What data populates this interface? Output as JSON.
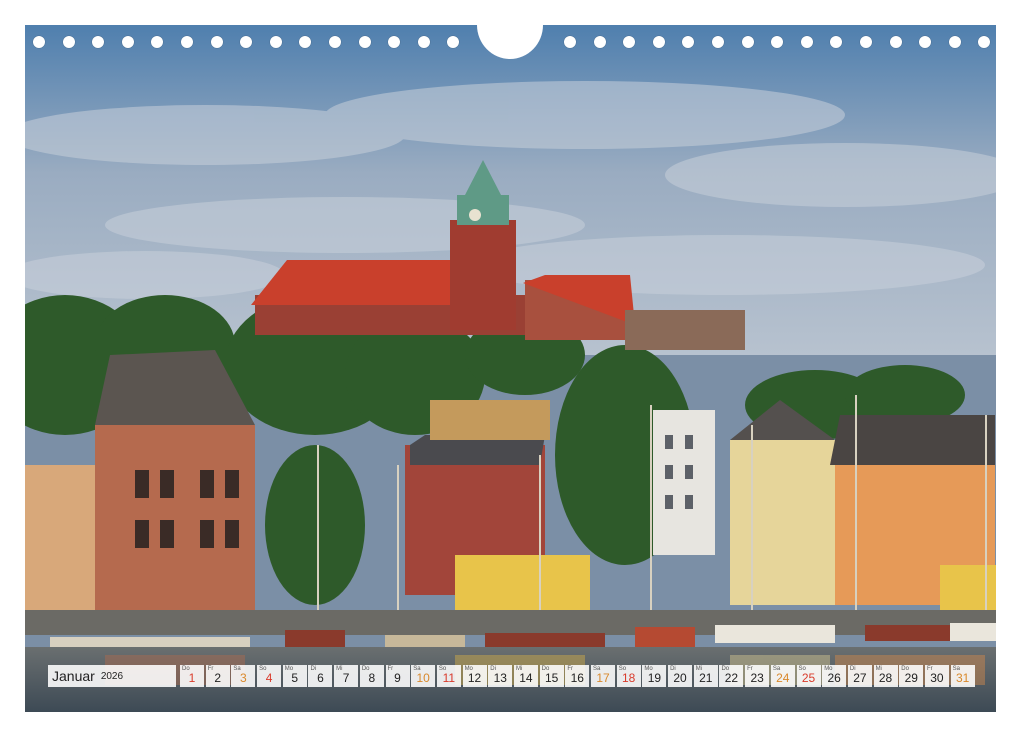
{
  "calendar": {
    "month": "Januar",
    "year": "2026",
    "days": [
      {
        "n": "1",
        "wd": "Do",
        "type": "hol"
      },
      {
        "n": "2",
        "wd": "Fr",
        "type": ""
      },
      {
        "n": "3",
        "wd": "Sa",
        "type": "sat"
      },
      {
        "n": "4",
        "wd": "So",
        "type": "sun"
      },
      {
        "n": "5",
        "wd": "Mo",
        "type": ""
      },
      {
        "n": "6",
        "wd": "Di",
        "type": ""
      },
      {
        "n": "7",
        "wd": "Mi",
        "type": ""
      },
      {
        "n": "8",
        "wd": "Do",
        "type": ""
      },
      {
        "n": "9",
        "wd": "Fr",
        "type": ""
      },
      {
        "n": "10",
        "wd": "Sa",
        "type": "sat"
      },
      {
        "n": "11",
        "wd": "So",
        "type": "sun"
      },
      {
        "n": "12",
        "wd": "Mo",
        "type": ""
      },
      {
        "n": "13",
        "wd": "Di",
        "type": ""
      },
      {
        "n": "14",
        "wd": "Mi",
        "type": ""
      },
      {
        "n": "15",
        "wd": "Do",
        "type": ""
      },
      {
        "n": "16",
        "wd": "Fr",
        "type": ""
      },
      {
        "n": "17",
        "wd": "Sa",
        "type": "sat"
      },
      {
        "n": "18",
        "wd": "So",
        "type": "sun"
      },
      {
        "n": "19",
        "wd": "Mo",
        "type": ""
      },
      {
        "n": "20",
        "wd": "Di",
        "type": ""
      },
      {
        "n": "21",
        "wd": "Mi",
        "type": ""
      },
      {
        "n": "22",
        "wd": "Do",
        "type": ""
      },
      {
        "n": "23",
        "wd": "Fr",
        "type": ""
      },
      {
        "n": "24",
        "wd": "Sa",
        "type": "sat"
      },
      {
        "n": "25",
        "wd": "So",
        "type": "sun"
      },
      {
        "n": "26",
        "wd": "Mo",
        "type": ""
      },
      {
        "n": "27",
        "wd": "Di",
        "type": ""
      },
      {
        "n": "28",
        "wd": "Mi",
        "type": ""
      },
      {
        "n": "29",
        "wd": "Do",
        "type": ""
      },
      {
        "n": "30",
        "wd": "Fr",
        "type": ""
      },
      {
        "n": "31",
        "wd": "Sa",
        "type": "sat"
      }
    ]
  },
  "colors": {
    "saturday": "#d9892b",
    "sunday": "#d93b2b",
    "sky": "#8fa4bd",
    "roof": "#c9402c",
    "water": "#4a5a6a"
  }
}
